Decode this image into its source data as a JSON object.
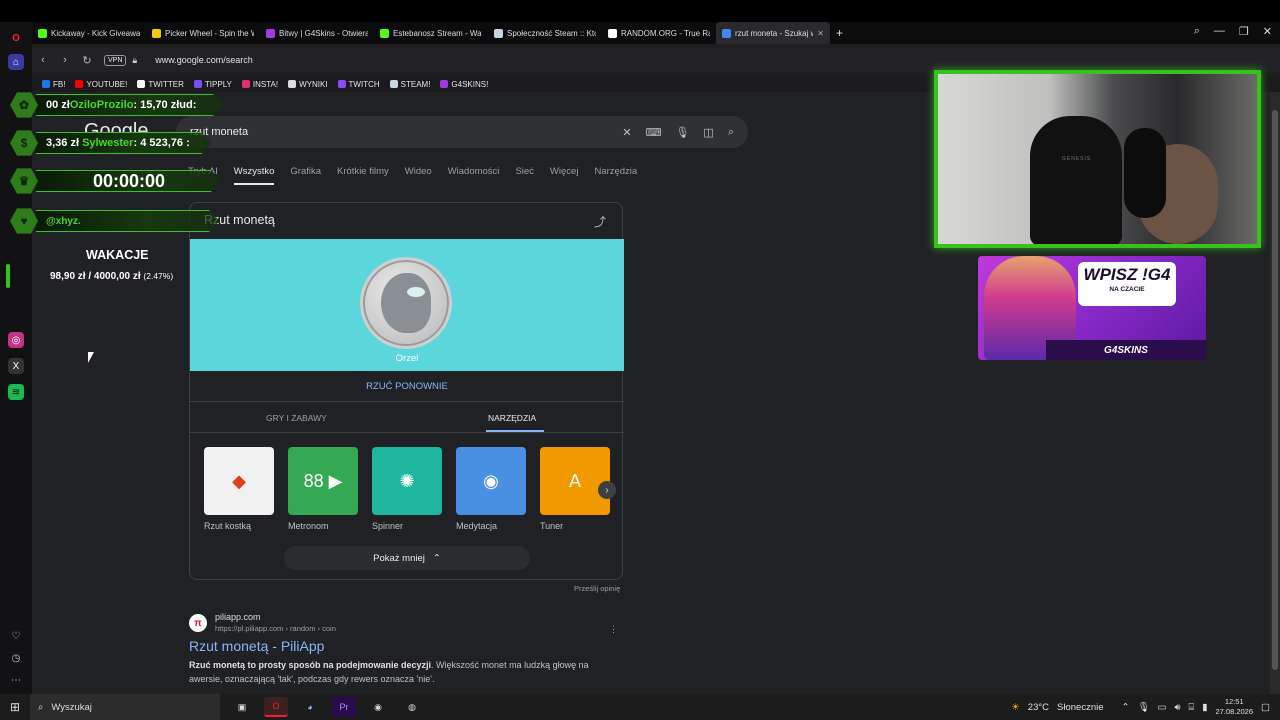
{
  "browser": {
    "tabs": [
      {
        "label": "Kickaway - Kick Giveaway",
        "color": "#53fc18"
      },
      {
        "label": "Picker Wheel - Spin the W",
        "color": "#f5c518"
      },
      {
        "label": "Bitwy | G4Skins - Otwieraj",
        "color": "#a33ae0"
      },
      {
        "label": "Estebanosz Stream - Watc",
        "color": "#53fc18"
      },
      {
        "label": "Społeczność Steam :: Kto :",
        "color": "#c7d5e0"
      },
      {
        "label": "RANDOM.ORG - True Ran",
        "color": "#ffffff"
      },
      {
        "label": "rzut moneta - Szukaj w Go",
        "color": "#4285f4"
      }
    ],
    "vpn_label": "VPN",
    "url": "www.google.com/search",
    "bookmarks": [
      {
        "label": "FB!",
        "color": "#1877f2"
      },
      {
        "label": "YOUTUBE!",
        "color": "#ff0000"
      },
      {
        "label": "TWITTER",
        "color": "#ffffff"
      },
      {
        "label": "TIPPLY",
        "color": "#7b4dff"
      },
      {
        "label": "INSTA!",
        "color": "#e1306c"
      },
      {
        "label": "WYNIKI",
        "color": "#dddddd"
      },
      {
        "label": "TWITCH",
        "color": "#9146ff"
      },
      {
        "label": "STEAM!",
        "color": "#c7d5e0"
      },
      {
        "label": "G4SKINS!",
        "color": "#a33ae0"
      }
    ]
  },
  "google": {
    "logo": "Google",
    "query": "rzut moneta",
    "tabs": [
      "Tryb AI",
      "Wszystko",
      "Grafika",
      "Krótkie filmy",
      "Wideo",
      "Wiadomości",
      "Sieć",
      "Więcej",
      "Narzędzia"
    ],
    "active_tab": "Wszystko",
    "card": {
      "title": "Rzut monetą",
      "coin_result": "Orzeł",
      "rethrow": "RZUĆ PONOWNIE",
      "tab_games": "GRY I ZABAWY",
      "tab_tools": "NARZĘDZIA",
      "tools": [
        {
          "label": "Rzut kostką",
          "bg": "#f1f1f1",
          "icon": "dice-icon",
          "glyph": "◆"
        },
        {
          "label": "Metronom",
          "bg": "#34a853",
          "icon": "metronome-icon",
          "glyph": "88 ▶"
        },
        {
          "label": "Spinner",
          "bg": "#1fb6a0",
          "icon": "spinner-icon",
          "glyph": "✺"
        },
        {
          "label": "Medytacja",
          "bg": "#4a90e2",
          "icon": "meditation-icon",
          "glyph": "◉"
        },
        {
          "label": "Tuner",
          "bg": "#f29900",
          "icon": "tuner-icon",
          "glyph": "A"
        }
      ],
      "show_less": "Pokaż mniej",
      "feedback": "Prześlij opinię"
    },
    "result": {
      "site": "piliapp.com",
      "url": "https://pl.piliapp.com › random › coin",
      "title": "Rzut monetą - PiliApp",
      "snippet_bold": "Rzuć monetą to prosty sposób na podejmowanie decyzji",
      "snippet_rest": ". Większość monet ma ludzką głowę na awersie, oznaczającą 'tak', podczas gdy rewers oznacza 'nie'."
    }
  },
  "overlay": {
    "donation1": {
      "amount": "00 zł",
      "name": "OziloProzilo",
      "rest": ": 15,70 zł",
      "suffix": "ud:"
    },
    "donation2": {
      "amount": "3,36 zł",
      "name": "Sylwester",
      "rest": ": 4 523,76 :"
    },
    "timer": "00:00:00",
    "follower": "@xhyz.",
    "goal_title": "WAKACJE",
    "goal_amount": "98,90 zł / 4000,00 zł",
    "goal_percent": "(2.47%)",
    "goal_progress": 0.0247,
    "accent": "#37c21e",
    "cam_brand": "GENESIS",
    "promo_title": "WPISZ !G4",
    "promo_sub": "NA CZACIE",
    "promo_brand": "G4SKINS"
  },
  "taskbar": {
    "search_placeholder": "Wyszukaj",
    "weather_temp": "23°C",
    "weather_desc": "Słonecznie",
    "time": "12:51",
    "date": "27.08.2026"
  }
}
